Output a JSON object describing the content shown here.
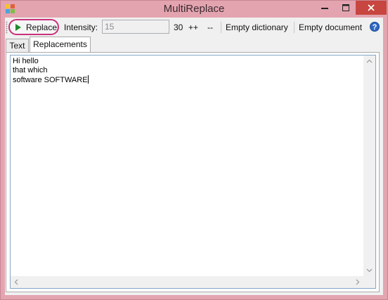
{
  "window": {
    "title": "MultiReplace",
    "icon": "app-icon",
    "controls": [
      "minimize-icon",
      "maximize-icon",
      "close-icon"
    ]
  },
  "toolbar": {
    "replace_label": "Replace",
    "intensity_label": "Intensity:",
    "intensity_value": "15",
    "intensity_max": "30",
    "increase_label": "++",
    "decrease_label": "--",
    "empty_dictionary_label": "Empty dictionary",
    "empty_document_label": "Empty document",
    "help_glyph": "?"
  },
  "tabs": [
    {
      "label": "Text",
      "selected": false
    },
    {
      "label": "Replacements",
      "selected": true
    }
  ],
  "editor": {
    "lines": [
      "Hi hello",
      "that which",
      "software SOFTWARE"
    ]
  },
  "colors": {
    "title_bar": "#e3a4b0",
    "close_button": "#c7463f",
    "replace_highlight": "#c8327a",
    "play_icon": "#1e8a2e",
    "help_icon": "#2d68c4"
  }
}
